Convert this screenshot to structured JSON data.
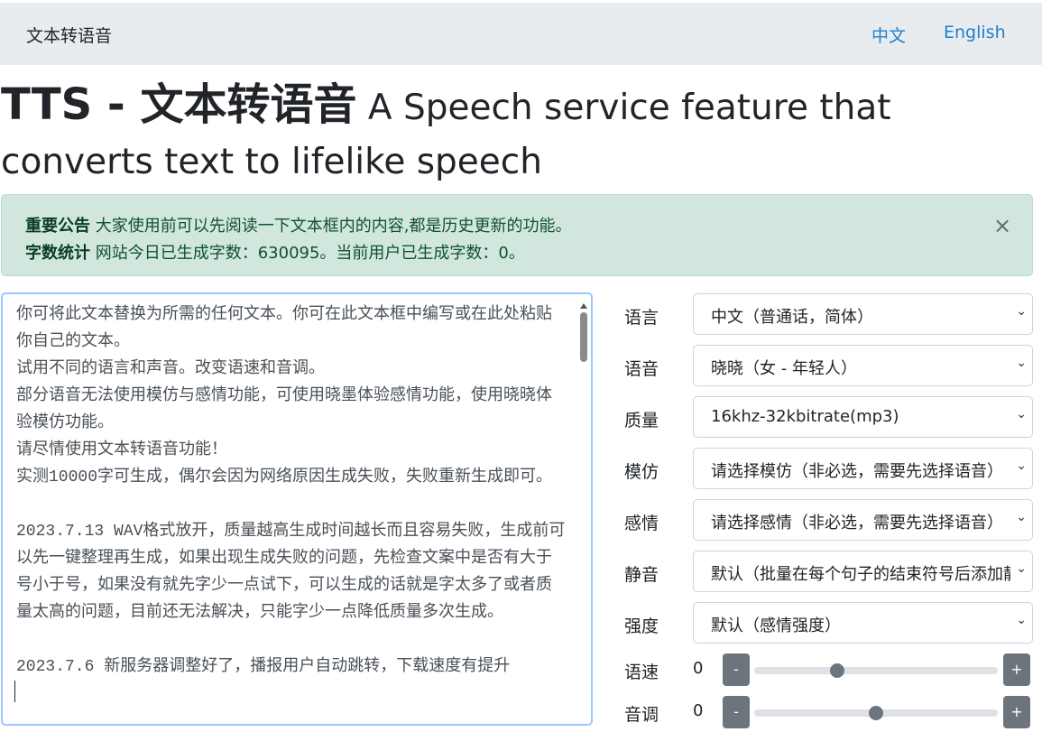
{
  "navbar": {
    "brand": "文本转语音",
    "lang_zh": "中文",
    "lang_en": "English"
  },
  "headline": {
    "main": "TTS - 文本转语音",
    "sub": " A Speech service feature that converts text to lifelike speech"
  },
  "alert": {
    "line1_label": "重要公告",
    "line1_text": " 大家使用前可以先阅读一下文本框内的内容,都是历史更新的功能。",
    "line2_label": "字数统计",
    "line2_text": " 网站今日已生成字数：630095。当前用户已生成字数：0。",
    "close": "×"
  },
  "textbox": {
    "content": "你可将此文本替换为所需的任何文本。你可在此文本框中编写或在此处粘贴你自己的文本。\n试用不同的语言和声音。改变语速和音调。\n部分语音无法使用模仿与感情功能，可使用晓墨体验感情功能，使用晓晓体验模仿功能。\n请尽情使用文本转语音功能！\n实测10000字可生成，偶尔会因为网络原因生成失败，失败重新生成即可。\n\n2023.7.13 WAV格式放开，质量越高生成时间越长而且容易失败，生成前可以先一键整理再生成，如果出现生成失败的问题，先检查文案中是否有大于号小于号，如果没有就先字少一点试下，可以生成的话就是字太多了或者质量太高的问题，目前还无法解决，只能字少一点降低质量多次生成。\n\n2023.7.6 新服务器调整好了，播报用户自动跳转，下载速度有提升"
  },
  "form": {
    "language": {
      "label": "语言",
      "value": "中文（普通话，简体）"
    },
    "voice": {
      "label": "语音",
      "value": "晓晓（女 - 年轻人）"
    },
    "quality": {
      "label": "质量",
      "value": "16khz-32kbitrate(mp3)"
    },
    "imitate": {
      "label": "模仿",
      "value": "请选择模仿（非必选，需要先选择语音）"
    },
    "emotion": {
      "label": "感情",
      "value": "请选择感情（非必选，需要先选择语音）"
    },
    "silence": {
      "label": "静音",
      "value": "默认（批量在每个句子的结束符号后添加静音）"
    },
    "intensity": {
      "label": "强度",
      "value": "默认（感情强度）"
    },
    "rate": {
      "label": "语速",
      "value": "0",
      "minus": "-",
      "plus": "+",
      "level": 0.34
    },
    "pitch": {
      "label": "音调",
      "value": "0",
      "minus": "-",
      "plus": "+",
      "level": 0.5
    }
  }
}
